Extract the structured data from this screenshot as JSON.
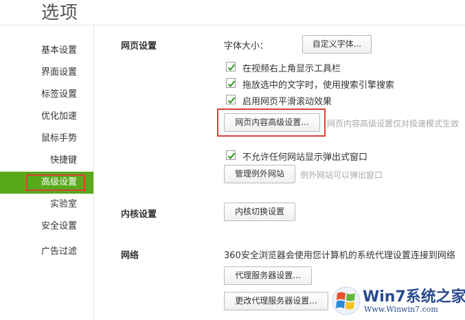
{
  "header": {
    "title": "选项"
  },
  "sidebar": {
    "items": [
      {
        "label": "基本设置"
      },
      {
        "label": "界面设置"
      },
      {
        "label": "标签设置"
      },
      {
        "label": "优化加速"
      },
      {
        "label": "鼠标手势"
      },
      {
        "label": "快捷键"
      },
      {
        "label": "高级设置",
        "active": true
      },
      {
        "label": "实验室"
      },
      {
        "label": "安全设置"
      },
      {
        "label": "广告过滤"
      }
    ]
  },
  "web_settings": {
    "section_label": "网页设置",
    "font_size_label": "字体大小：",
    "custom_font_button": "自定义字体...",
    "checkboxes": [
      {
        "label": "在视频右上角显示工具栏",
        "checked": true
      },
      {
        "label": "拖放选中的文字时，使用搜索引擎搜索",
        "checked": true
      },
      {
        "label": "启用网页平滑滚动效果",
        "checked": true
      }
    ],
    "advanced_button": "网页内容高级设置...",
    "advanced_hint": "网页内容高级设置仅对极速模式生效",
    "popup_checkbox": {
      "label": "不允许任何网站显示弹出式窗口",
      "checked": true
    },
    "manage_exceptions_button": "管理例外网站",
    "exceptions_hint": "例外网站可以弹出窗口"
  },
  "kernel_settings": {
    "section_label": "内核设置",
    "switch_button": "内核切换设置"
  },
  "network": {
    "section_label": "网络",
    "description": "360安全浏览器会使用您计算机的系统代理设置连接到网络",
    "proxy_button": "代理服务器设置...",
    "change_proxy_button": "更改代理服务器设置..."
  },
  "watermark": {
    "title": "Win7系统之家",
    "url": "Www.Winwin7.com"
  },
  "colors": {
    "accent_green": "#5aa81c",
    "highlight_red": "#d94136",
    "check_green": "#3a9a2a"
  }
}
